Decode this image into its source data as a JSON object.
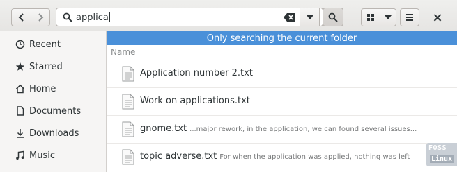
{
  "header": {
    "back_icon": "chevron-left-icon",
    "forward_icon": "chevron-right-icon",
    "search": {
      "value": "applica",
      "icon": "search-icon",
      "clear_icon": "clear-text-icon"
    },
    "dropdown_icon": "caret-down-icon",
    "search_button_icon": "search-icon",
    "view_icon": "grid-view-icon",
    "view_options_icon": "caret-down-icon",
    "menu_icon": "hamburger-menu-icon",
    "close_label": "×"
  },
  "sidebar": {
    "items": [
      {
        "label": "Recent",
        "icon": "clock-icon"
      },
      {
        "label": "Starred",
        "icon": "star-icon"
      },
      {
        "label": "Home",
        "icon": "home-icon"
      },
      {
        "label": "Documents",
        "icon": "document-icon"
      },
      {
        "label": "Downloads",
        "icon": "download-icon"
      },
      {
        "label": "Music",
        "icon": "music-icon"
      }
    ]
  },
  "main": {
    "banner": "Only searching the current folder",
    "column_header": "Name",
    "files": [
      {
        "name": "Application number 2.txt",
        "snippet": ""
      },
      {
        "name": "Work on applications.txt",
        "snippet": ""
      },
      {
        "name": "gnome.txt",
        "snippet": "...major rework, in the application, we can found several issues..."
      },
      {
        "name": "topic adverse.txt",
        "snippet": "For when the application was applied, nothing was left"
      }
    ]
  },
  "watermark": {
    "line1": "FOSS",
    "line2": "Linux"
  },
  "colors": {
    "accent": "#4a90d9",
    "sidebar_bg": "#f6f5f4",
    "header_bg": "#e8e7e5"
  }
}
